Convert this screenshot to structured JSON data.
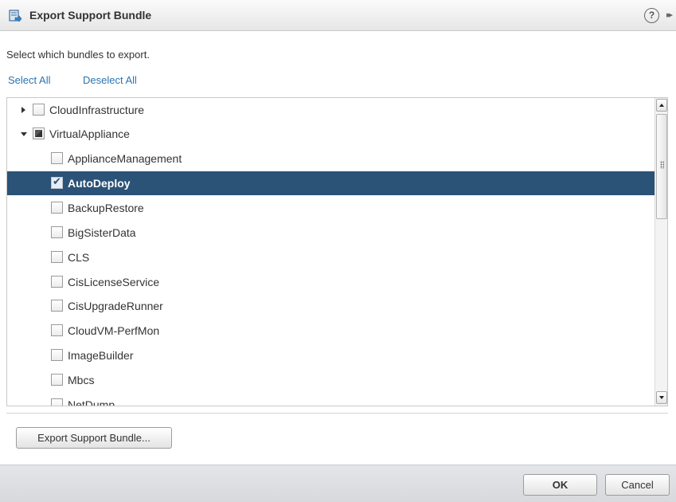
{
  "dialog": {
    "title": "Export Support Bundle",
    "help_glyph": "?",
    "more_glyph": "▸▸"
  },
  "instruction": "Select which bundles to export.",
  "links": {
    "select_all": "Select All",
    "deselect_all": "Deselect All"
  },
  "tree": {
    "items": [
      {
        "label": "CloudInfrastructure",
        "level": 0,
        "expander": "collapsed",
        "state": "unchecked"
      },
      {
        "label": "VirtualAppliance",
        "level": 0,
        "expander": "expanded",
        "state": "partial"
      },
      {
        "label": "ApplianceManagement",
        "level": 1,
        "state": "unchecked"
      },
      {
        "label": "AutoDeploy",
        "level": 1,
        "state": "checked",
        "selected": true
      },
      {
        "label": "BackupRestore",
        "level": 1,
        "state": "unchecked"
      },
      {
        "label": "BigSisterData",
        "level": 1,
        "state": "unchecked"
      },
      {
        "label": "CLS",
        "level": 1,
        "state": "unchecked"
      },
      {
        "label": "CisLicenseService",
        "level": 1,
        "state": "unchecked"
      },
      {
        "label": "CisUpgradeRunner",
        "level": 1,
        "state": "unchecked"
      },
      {
        "label": "CloudVM-PerfMon",
        "level": 1,
        "state": "unchecked"
      },
      {
        "label": "ImageBuilder",
        "level": 1,
        "state": "unchecked"
      },
      {
        "label": "Mbcs",
        "level": 1,
        "state": "unchecked"
      },
      {
        "label": "NetDump",
        "level": 1,
        "state": "unchecked"
      }
    ]
  },
  "buttons": {
    "export": "Export Support Bundle...",
    "ok": "OK",
    "cancel": "Cancel"
  },
  "colors": {
    "selection": "#2b5277",
    "link": "#2b74b0"
  }
}
